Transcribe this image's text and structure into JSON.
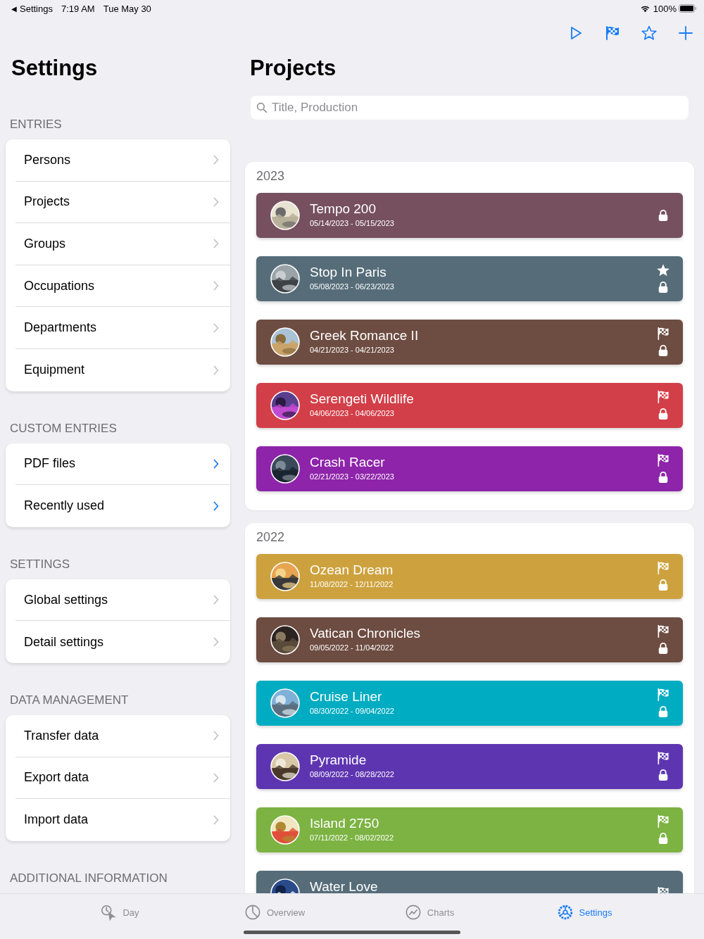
{
  "status_bar": {
    "back_arrow": "◀",
    "back_label": "Settings",
    "time": "7:19 AM",
    "date": "Tue May 30",
    "battery": "100%"
  },
  "sidebar": {
    "title": "Settings",
    "sections": [
      {
        "header": "ENTRIES",
        "kind": "standard",
        "items": [
          "Persons",
          "Projects",
          "Groups",
          "Occupations",
          "Departments",
          "Equipment"
        ]
      },
      {
        "header": "CUSTOM ENTRIES",
        "kind": "custom",
        "items": [
          "PDF files",
          "Recently used"
        ]
      },
      {
        "header": "SETTINGS",
        "kind": "standard",
        "items": [
          "Global settings",
          "Detail settings"
        ]
      },
      {
        "header": "DATA MANAGEMENT",
        "kind": "standard",
        "items": [
          "Transfer data",
          "Export data",
          "Import data"
        ]
      }
    ],
    "trailing_header": "ADDITIONAL INFORMATION"
  },
  "projects": {
    "title": "Projects",
    "search": {
      "placeholder": "Title, Production"
    },
    "groups": [
      {
        "year": "2023",
        "items": [
          {
            "name": "Tempo 200",
            "dates": "05/14/2023 - 05/15/2023",
            "color": "#76505f",
            "starred": false,
            "flagged": false,
            "locked": true
          },
          {
            "name": "Stop In Paris",
            "dates": "05/08/2023 - 06/23/2023",
            "color": "#566d79",
            "starred": true,
            "flagged": false,
            "locked": true
          },
          {
            "name": "Greek Romance II",
            "dates": "04/21/2023 - 04/21/2023",
            "color": "#6d4c41",
            "starred": false,
            "flagged": true,
            "locked": true
          },
          {
            "name": "Serengeti Wildlife",
            "dates": "04/06/2023 - 04/06/2023",
            "color": "#d23f48",
            "starred": false,
            "flagged": true,
            "locked": true
          },
          {
            "name": "Crash Racer",
            "dates": "02/21/2023 - 03/22/2023",
            "color": "#8e24aa",
            "starred": false,
            "flagged": true,
            "locked": true
          }
        ]
      },
      {
        "year": "2022",
        "items": [
          {
            "name": "Ozean Dream",
            "dates": "11/08/2022 - 12/11/2022",
            "color": "#cda23e",
            "starred": false,
            "flagged": true,
            "locked": true
          },
          {
            "name": "Vatican Chronicles",
            "dates": "09/05/2022 - 11/04/2022",
            "color": "#6d4c41",
            "starred": false,
            "flagged": true,
            "locked": true
          },
          {
            "name": "Cruise Liner",
            "dates": "08/30/2022 - 09/04/2022",
            "color": "#00acc1",
            "starred": false,
            "flagged": true,
            "locked": true
          },
          {
            "name": "Pyramide",
            "dates": "08/09/2022 - 08/28/2022",
            "color": "#5e35b1",
            "starred": false,
            "flagged": true,
            "locked": true
          },
          {
            "name": "Island 2750",
            "dates": "07/11/2022 - 08/02/2022",
            "color": "#7cb342",
            "starred": false,
            "flagged": true,
            "locked": true
          },
          {
            "name": "Water Love",
            "color": "#566d79",
            "starred": false,
            "flagged": true
          }
        ]
      }
    ]
  },
  "tabs": [
    {
      "label": "Day",
      "kind": "day",
      "selected": false
    },
    {
      "label": "Overview",
      "kind": "overview",
      "selected": false
    },
    {
      "label": "Charts",
      "kind": "charts",
      "selected": false
    },
    {
      "label": "Settings",
      "kind": "settings",
      "selected": true
    }
  ]
}
